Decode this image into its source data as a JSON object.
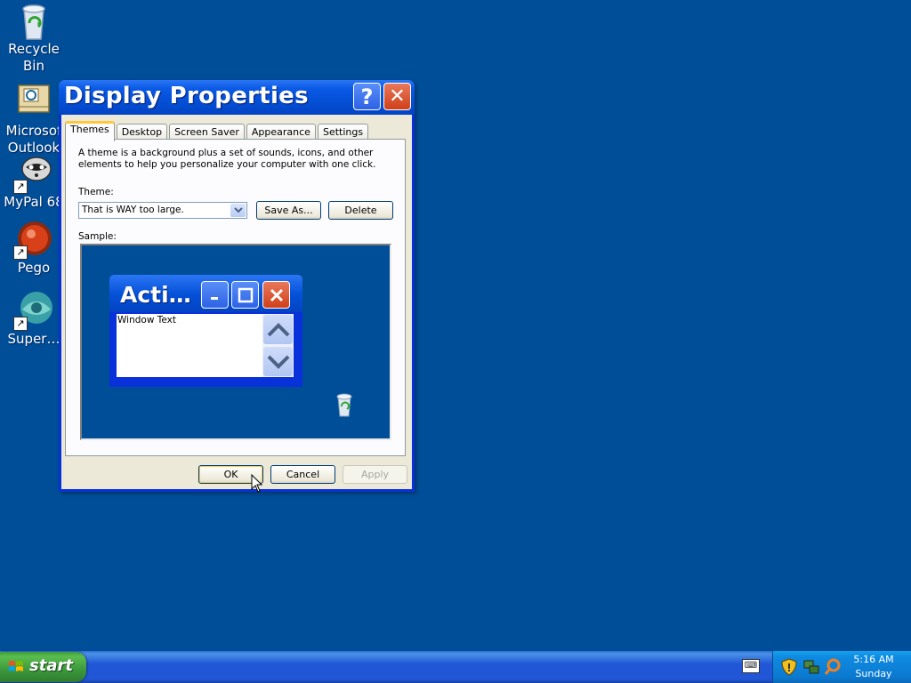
{
  "desktop": {
    "icons": [
      {
        "label": "Recycle Bin",
        "line1": "Recycle",
        "line2": "Bin"
      },
      {
        "label": "Microsoft Outlook",
        "line1": "Microsof",
        "line2": "Outlook"
      },
      {
        "label": "MyPal 68",
        "line1": "MyPal 68",
        "line2": ""
      },
      {
        "label": "Pego",
        "line1": "Pego",
        "line2": ""
      },
      {
        "label": "Super...",
        "line1": "Super…",
        "line2": ""
      }
    ]
  },
  "dialog": {
    "title": "Display Properties",
    "help_glyph": "?",
    "close_glyph": "✕",
    "tabs": [
      "Themes",
      "Desktop",
      "Screen Saver",
      "Appearance",
      "Settings"
    ],
    "active_tab": "Themes",
    "description": "A theme is a background plus a set of sounds, icons, and other elements to help you personalize your computer with one click.",
    "theme_label": "Theme:",
    "theme_value": "That is WAY too large.",
    "save_as_label": "Save As...",
    "delete_label": "Delete",
    "sample_label": "Sample:",
    "sample": {
      "window_title": "Acti…",
      "window_text": "Window Text"
    },
    "ok_label": "OK",
    "cancel_label": "Cancel",
    "apply_label": "Apply"
  },
  "taskbar": {
    "start_label": "start",
    "clock_time": "5:16 AM",
    "clock_day": "Sunday"
  },
  "colors": {
    "desktop_bg": "#004e98",
    "title_blue": "#0450d6",
    "close_red": "#d0401a",
    "start_green": "#3c983c",
    "dialog_face": "#ece9d8"
  }
}
